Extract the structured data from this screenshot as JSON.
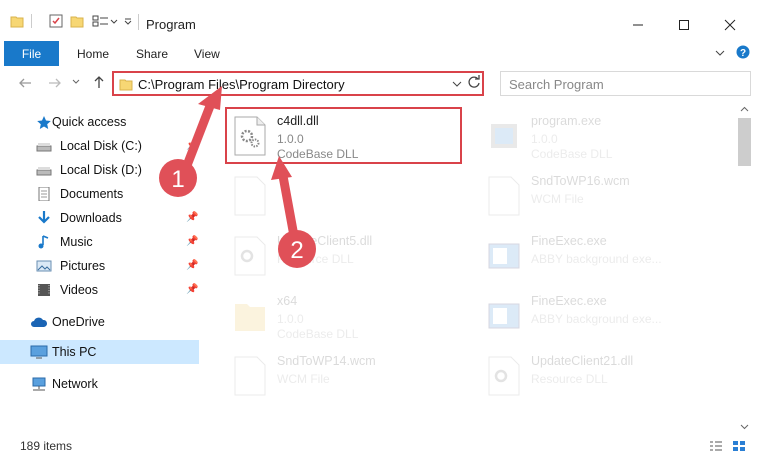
{
  "window": {
    "title": "Program"
  },
  "ribbon": {
    "tabs": [
      "File",
      "Home",
      "Share",
      "View"
    ]
  },
  "address": {
    "path": "C:\\Program Files\\Program Directory",
    "search_placeholder": "Search Program"
  },
  "sidebar": {
    "items": [
      {
        "label": "Quick access",
        "icon": "star-icon"
      },
      {
        "label": "Local Disk (C:)",
        "icon": "drive-icon"
      },
      {
        "label": "Local Disk (D:)",
        "icon": "drive-icon"
      },
      {
        "label": "Documents",
        "icon": "documents-icon"
      },
      {
        "label": "Downloads",
        "icon": "download-icon"
      },
      {
        "label": "Music",
        "icon": "music-icon"
      },
      {
        "label": "Pictures",
        "icon": "pictures-icon"
      },
      {
        "label": "Videos",
        "icon": "videos-icon"
      },
      {
        "label": "OneDrive",
        "icon": "cloud-icon"
      },
      {
        "label": "This PC",
        "icon": "computer-icon"
      },
      {
        "label": "Network",
        "icon": "network-icon"
      }
    ]
  },
  "files": [
    {
      "name": "c4dll.dll",
      "version": "1.0.0",
      "type": "CodeBase DLL"
    },
    {
      "name": "program.exe",
      "version": "1.0.0",
      "type": "CodeBase DLL"
    },
    {
      "name": "",
      "version": "",
      "type": ""
    },
    {
      "name": "SndToWP16.wcm",
      "version": "",
      "type": "WCM File"
    },
    {
      "name": "UpdateClient5.dll",
      "version": "",
      "type": "Resource DLL"
    },
    {
      "name": "FineExec.exe",
      "version": "",
      "type": "ABBY background exe..."
    },
    {
      "name": "x64",
      "version": "1.0.0",
      "type": "CodeBase DLL"
    },
    {
      "name": "FineExec.exe",
      "version": "",
      "type": "ABBY background exe..."
    },
    {
      "name": "SndToWP14.wcm",
      "version": "",
      "type": "WCM File"
    },
    {
      "name": "UpdateClient21.dll",
      "version": "",
      "type": "Resource DLL"
    }
  ],
  "annotations": {
    "step1": "1",
    "step2": "2"
  },
  "status": {
    "item_count": "189 items"
  },
  "colors": {
    "accent": "#1979ca",
    "highlight": "#d9434a",
    "selected": "#cce8ff"
  }
}
